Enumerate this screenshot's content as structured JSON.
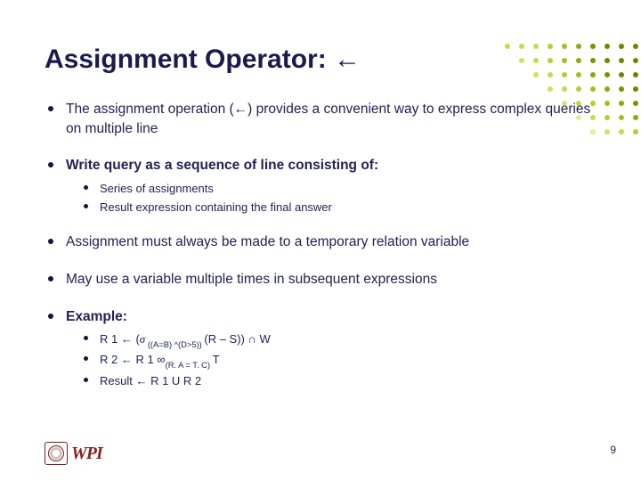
{
  "title": "Assignment Operator: ←",
  "bullets": {
    "b1": "The assignment operation (←) provides a convenient way to express complex queries on multiple line",
    "b2": "Write query as a sequence of line consisting of:",
    "b2_1": "Series of assignments",
    "b2_2": "Result expression containing the final answer",
    "b3": "Assignment must always be made to a temporary relation variable",
    "b4": "May use a variable multiple times in subsequent expressions",
    "b5": "Example:",
    "b5_1_a": "R 1 ← (",
    "b5_1_sigma": "σ",
    "b5_1_sub": " ((A=B) ^(D>5)) ",
    "b5_1_b": "(R – S)) ∩ W",
    "b5_2_a": "R 2 ← R 1 ",
    "b5_2_join": "∞",
    "b5_2_sub": "(R. A = T. C) ",
    "b5_2_b": "T",
    "b5_3": "Result ← R 1 U R 2"
  },
  "logo_text": "WPI",
  "page_number": "9"
}
